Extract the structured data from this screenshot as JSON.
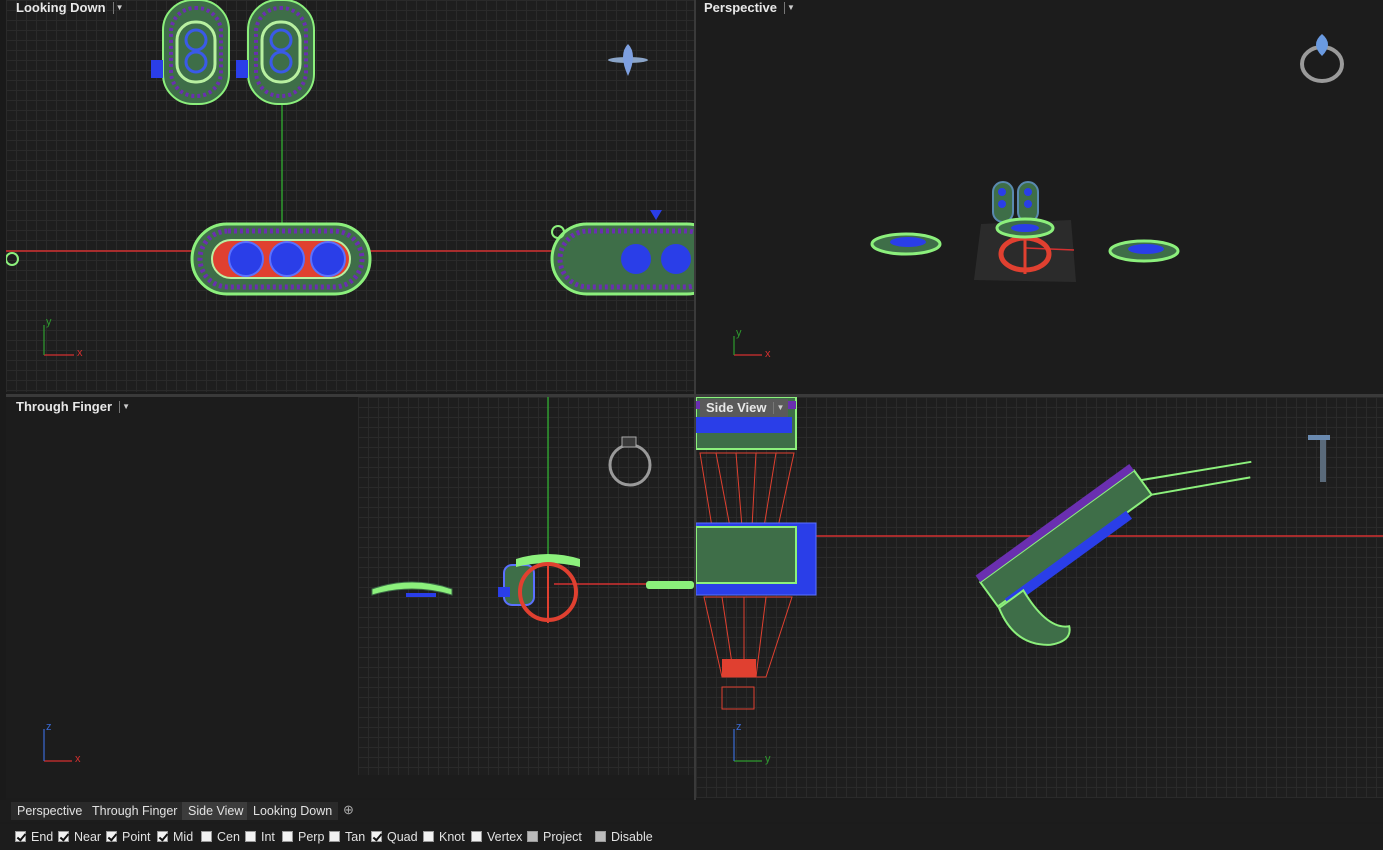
{
  "viewports": {
    "looking_down": {
      "title": "Looking Down",
      "axis_x": "x",
      "axis_y": "y"
    },
    "perspective": {
      "title": "Perspective",
      "axis_x": "x",
      "axis_y": "y"
    },
    "through_finger": {
      "title": "Through Finger",
      "axis_x": "x",
      "axis_y": "z"
    },
    "side_view": {
      "title": "Side View",
      "axis_x": "y",
      "axis_y": "z",
      "active": true
    }
  },
  "tabs": [
    "Perspective",
    "Through Finger",
    "Side View",
    "Looking Down"
  ],
  "snaps": [
    {
      "label": "End",
      "checked": true
    },
    {
      "label": "Near",
      "checked": true
    },
    {
      "label": "Point",
      "checked": true
    },
    {
      "label": "Mid",
      "checked": true
    },
    {
      "label": "Cen",
      "checked": false
    },
    {
      "label": "Int",
      "checked": false
    },
    {
      "label": "Perp",
      "checked": false
    },
    {
      "label": "Tan",
      "checked": false
    },
    {
      "label": "Quad",
      "checked": true
    },
    {
      "label": "Knot",
      "checked": false
    },
    {
      "label": "Vertex",
      "checked": false
    },
    {
      "label": "Project",
      "checked": false
    },
    {
      "label": "Disable",
      "checked": false
    }
  ],
  "colors": {
    "x_axis": "#d43030",
    "y_axis": "#2e9c2e",
    "z_axis": "#3a6ad4",
    "wire_green": "#8cf07c",
    "gem_blue": "#2a3ee8",
    "metal_red": "#e04030"
  }
}
